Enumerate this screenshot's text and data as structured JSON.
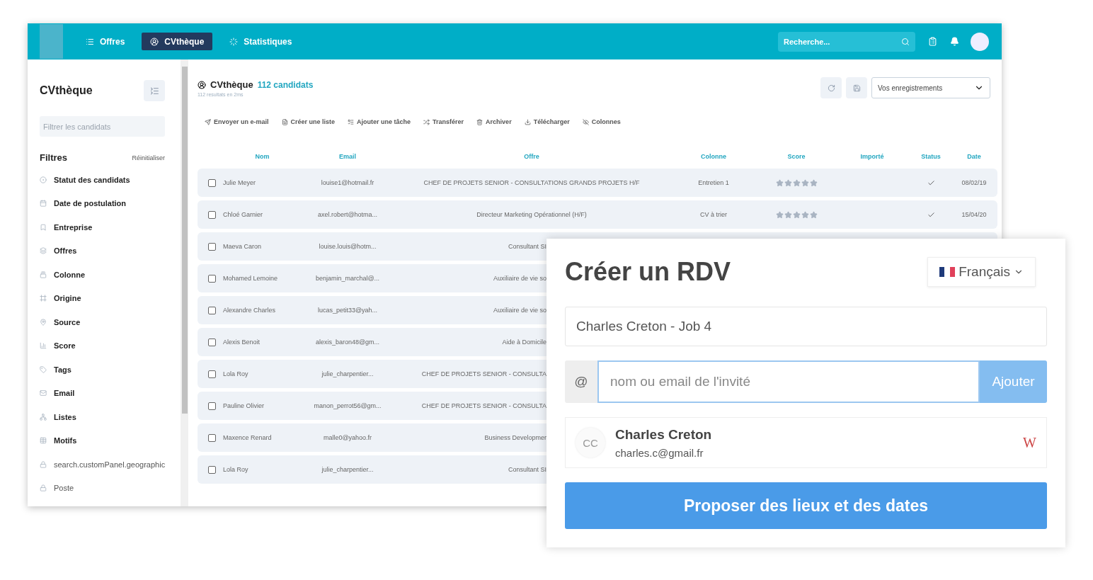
{
  "navbar": {
    "items": [
      {
        "label": "Offres",
        "selected": false
      },
      {
        "label": "CVthèque",
        "selected": true
      },
      {
        "label": "Statistiques",
        "selected": false
      }
    ],
    "search": {
      "placeholder": "Recherche..."
    }
  },
  "sidebar": {
    "title": "CVthèque",
    "filter_field": {
      "placeholder": "Filtrer les candidats"
    },
    "filters_heading": "Filtres",
    "reset": "Réinitialiser",
    "items": [
      {
        "label": "Statut des candidats",
        "locked": false
      },
      {
        "label": "Date de postulation",
        "locked": false
      },
      {
        "label": "Entreprise",
        "locked": false
      },
      {
        "label": "Offres",
        "locked": false
      },
      {
        "label": "Colonne",
        "locked": false
      },
      {
        "label": "Origine",
        "locked": false
      },
      {
        "label": "Source",
        "locked": false
      },
      {
        "label": "Score",
        "locked": false
      },
      {
        "label": "Tags",
        "locked": false
      },
      {
        "label": "Email",
        "locked": false
      },
      {
        "label": "Listes",
        "locked": false
      },
      {
        "label": "Motifs",
        "locked": false
      },
      {
        "label": "search.customPanel.geographic",
        "locked": true
      },
      {
        "label": "Poste",
        "locked": true
      }
    ]
  },
  "main": {
    "title": "CVthèque",
    "count": "112 candidats",
    "subtitle": "112 resultats en 2ms",
    "saved_select": "Vos enregistrements",
    "actions": [
      "Envoyer un e-mail",
      "Créer une liste",
      "Ajouter une tâche",
      "Transférer",
      "Archiver",
      "Télécharger",
      "Colonnes"
    ],
    "table": {
      "columns": [
        "Nom",
        "Email",
        "Offre",
        "Colonne",
        "Score",
        "Importé",
        "Status",
        "Date"
      ],
      "rows": [
        {
          "nom": "Julie Meyer",
          "email": "louise1@hotmail.fr",
          "offre": "CHEF DE PROJETS SENIOR - CONSULTATIONS GRANDS PROJETS H/F",
          "colonne": "Entretien 1",
          "stars": 5,
          "status_checked": true,
          "date": "08/02/19",
          "checked": false
        },
        {
          "nom": "Chloé Garnier",
          "email": "axel.robert@hotma...",
          "offre": "Directeur Marketing Opérationnel (H/F)",
          "colonne": "CV à trier",
          "stars": 5,
          "status_checked": true,
          "date": "15/04/20",
          "checked": false
        },
        {
          "nom": "Maeva Caron",
          "email": "louise.louis@hotm...",
          "offre": "Consultant SI",
          "checked": false
        },
        {
          "nom": "Mohamed Lemoine",
          "email": "benjamin_marchal@...",
          "offre": "Auxiliaire de vie so",
          "checked": false
        },
        {
          "nom": "Alexandre Charles",
          "email": "lucas_petit33@yah...",
          "offre": "Auxiliaire de vie so",
          "checked": false
        },
        {
          "nom": "Alexis Benoit",
          "email": "alexis_baron48@gm...",
          "offre": "Aide à Domicile",
          "checked": false
        },
        {
          "nom": "Lola Roy",
          "email": "julie_charpentier...",
          "offre": "CHEF DE PROJETS SENIOR - CONSULTA",
          "checked": false
        },
        {
          "nom": "Pauline Olivier",
          "email": "manon_perrot56@gm...",
          "offre": "CHEF DE PROJETS SENIOR - CONSULTA",
          "checked": false
        },
        {
          "nom": "Maxence Renard",
          "email": "malle0@yahoo.fr",
          "offre": "Business Developmer",
          "checked": false
        },
        {
          "nom": "Lola Roy",
          "email": "julie_charpentier...",
          "offre": "Consultant SI",
          "checked": false
        }
      ]
    }
  },
  "modal": {
    "title": "Créer un RDV",
    "language": "Français",
    "event_title": "Charles Creton - Job 4",
    "guest_field": {
      "prefix": "@",
      "placeholder": "nom ou email de l'invité",
      "button": "Ajouter"
    },
    "guests": [
      {
        "initials": "CC",
        "name": "Charles Creton",
        "email": "charles.c@gmail.fr",
        "badge": "W"
      }
    ],
    "submit": "Proposer des lieux et des dates"
  }
}
